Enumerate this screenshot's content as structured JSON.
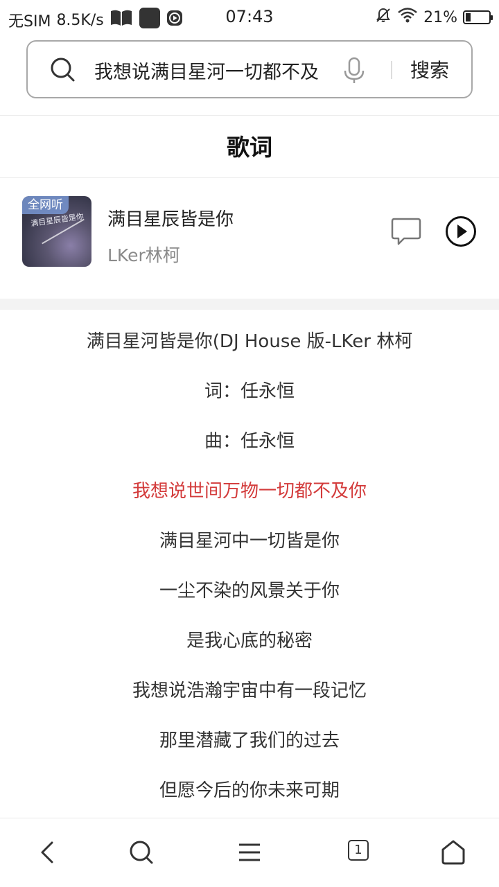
{
  "status_bar": {
    "carrier": "无SIM",
    "speed": "8.5K/s",
    "time": "07:43",
    "battery_percent": "21%",
    "battery_level": 0.21,
    "icons": [
      "book-icon",
      "app-square-icon",
      "media-play-icon",
      "bell-off-icon",
      "wifi-icon",
      "battery-icon"
    ]
  },
  "search": {
    "query": "我想说满目星河一切都不及",
    "button_label": "搜索"
  },
  "section": {
    "title": "歌词"
  },
  "song": {
    "badge": "全网听",
    "album_art_text": "满目星辰皆是你",
    "title": "满目星辰皆是你",
    "artist": "LKer林柯"
  },
  "lyrics": {
    "lines": [
      {
        "text": "满目星河皆是你(DJ House 版-LKer 林柯",
        "active": false
      },
      {
        "text": "词：任永恒",
        "active": false
      },
      {
        "text": "曲：任永恒",
        "active": false
      },
      {
        "text": "我想说世间万物一切都不及你",
        "active": true
      },
      {
        "text": "满目星河中一切皆是你",
        "active": false
      },
      {
        "text": "一尘不染的风景关于你",
        "active": false
      },
      {
        "text": "是我心底的秘密",
        "active": false
      },
      {
        "text": "我想说浩瀚宇宙中有一段记忆",
        "active": false
      },
      {
        "text": "那里潜藏了我们的过去",
        "active": false
      },
      {
        "text": "但愿今后的你未来可期",
        "active": false
      }
    ]
  },
  "bottom_nav": {
    "tab_count": "1",
    "icons": [
      "back-icon",
      "search-icon",
      "menu-icon",
      "tabs-icon",
      "home-icon"
    ]
  },
  "colors": {
    "active_lyric": "#d33b3b",
    "artist_gray": "#8a8a8a",
    "border": "#a8a8a8"
  }
}
